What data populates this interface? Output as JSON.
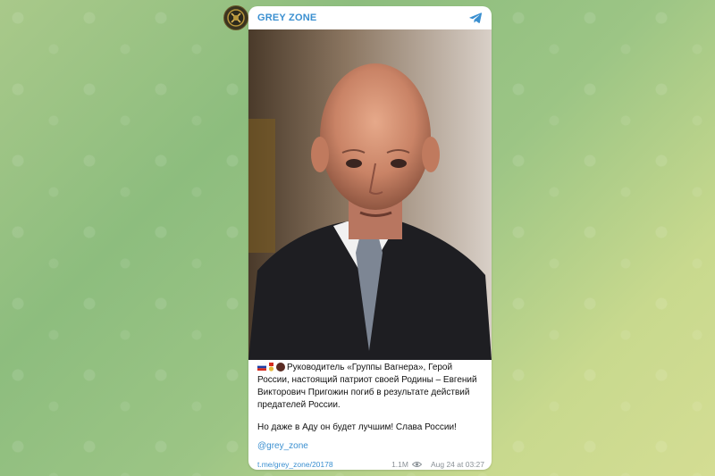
{
  "channel": {
    "name": "GREY ZONE",
    "avatar_icon": "wagner-badge-icon",
    "app_icon": "telegram-icon",
    "accent_color": "#3a8fd0"
  },
  "post": {
    "text_line1": "Руководитель «Группы Вагнера», Герой России, настоящий патриот своей Родины – Евгений Викторович Пригожин погиб в результате действий предателей России.",
    "text_line2": "Но даже в Аду он будет лучшим! Слава России!",
    "mention": "@grey_zone",
    "link": "t.me/grey_zone/20178",
    "views": "1.1M",
    "timestamp": "Aug 24 at 03:27"
  }
}
